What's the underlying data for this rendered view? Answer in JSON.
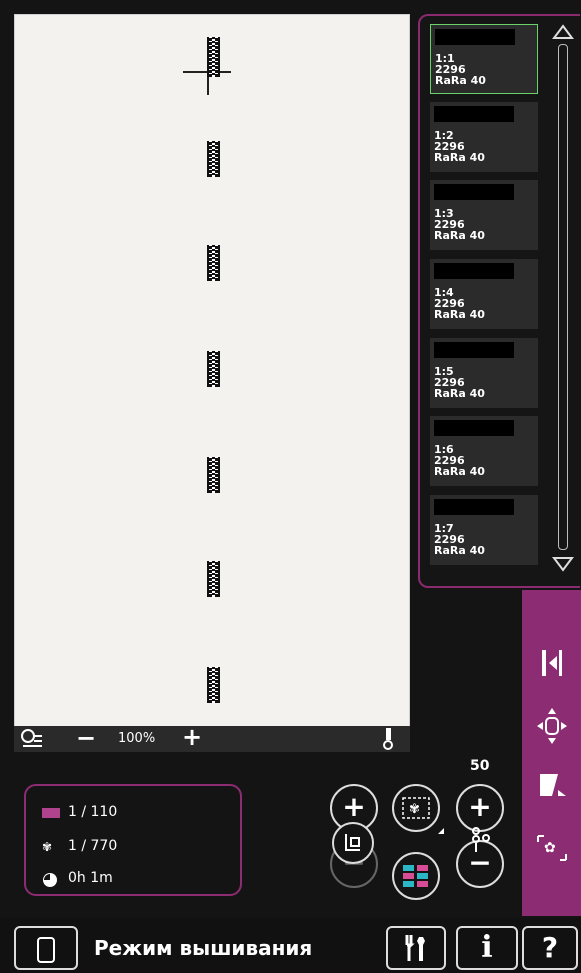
{
  "canvas": {
    "zoom_label": "100%",
    "zoom_minus": "−",
    "zoom_plus": "+"
  },
  "color_list": {
    "items": [
      {
        "index": "1:1",
        "code": "2296",
        "thread": "RaRa 40",
        "selected": true
      },
      {
        "index": "1:2",
        "code": "2296",
        "thread": "RaRa 40",
        "selected": false
      },
      {
        "index": "1:3",
        "code": "2296",
        "thread": "RaRa 40",
        "selected": false
      },
      {
        "index": "1:4",
        "code": "2296",
        "thread": "RaRa 40",
        "selected": false
      },
      {
        "index": "1:5",
        "code": "2296",
        "thread": "RaRa 40",
        "selected": false
      },
      {
        "index": "1:6",
        "code": "2296",
        "thread": "RaRa 40",
        "selected": false
      },
      {
        "index": "1:7",
        "code": "2296",
        "thread": "RaRa 40",
        "selected": false
      }
    ]
  },
  "info": {
    "color_blocks": "1 / 110",
    "stitches": "1 / 770",
    "time": "0h 1m"
  },
  "controls": {
    "step_value": "50"
  },
  "bottom": {
    "mode_title": "Режим вышивания"
  },
  "colors": {
    "accent": "#8c2c72",
    "selected_border": "#6bd26b",
    "canvas_bg": "#f3f2ee"
  }
}
